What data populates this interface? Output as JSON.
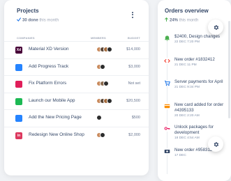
{
  "projects": {
    "title": "Projects",
    "done_count": "30 done",
    "done_period": "this month",
    "menu_icon": "more-vertical-icon",
    "columns": {
      "companies": "COMPANIES",
      "members": "MEMBERS",
      "budget": "BUDGET"
    },
    "rows": [
      {
        "name": "Material XD Version",
        "budget": "$14,000",
        "logo_icon": "adobe-xd-logo",
        "logo_text": "Xd",
        "logo_color": "#470137",
        "avatars": [
          "#c98b5e",
          "#5a4636",
          "#a36a3c",
          "#2d2d2d"
        ]
      },
      {
        "name": "Add Progress Track",
        "budget": "$3,000",
        "logo_icon": "atlassian-logo",
        "logo_text": "",
        "logo_color": "#2684ff",
        "avatars": [
          "#c98b5e",
          "#2d2d2d"
        ]
      },
      {
        "name": "Fix Platform Errors",
        "budget": "Not set",
        "logo_icon": "slack-logo",
        "logo_text": "",
        "logo_color": "#e01e5a",
        "avatars": [
          "#c98b5e",
          "#8a6a4e",
          "#2d2d2d"
        ]
      },
      {
        "name": "Launch our Mobile App",
        "budget": "$20,500",
        "logo_icon": "spotify-logo",
        "logo_text": "",
        "logo_color": "#1db954",
        "avatars": [
          "#c98b5e",
          "#5a4636",
          "#a36a3c",
          "#2d2d2d"
        ]
      },
      {
        "name": "Add the New Pricing Page",
        "budget": "$500",
        "logo_icon": "jira-logo",
        "logo_text": "",
        "logo_color": "#2684ff",
        "avatars": [
          "#2d2d2d"
        ]
      },
      {
        "name": "Redesign New Online Shop",
        "budget": "$2,000",
        "logo_icon": "invision-logo",
        "logo_text": "in",
        "logo_color": "#dc395f",
        "avatars": [
          "#c98b5e",
          "#2d2d2d"
        ]
      }
    ]
  },
  "orders": {
    "title": "Orders overview",
    "percent": "24%",
    "period": "this month",
    "trend_icon": "arrow-up-icon",
    "items": [
      {
        "title": "$2400, Design changes",
        "date": "22 DEC 7:20 PM",
        "icon": "bell-icon",
        "color": "#4caf50"
      },
      {
        "title": "New order #1832412",
        "date": "21 DEC 11 PM",
        "icon": "code-icon",
        "color": "#f44335"
      },
      {
        "title": "Server payments for April",
        "date": "21 DEC 9:34 PM",
        "icon": "cart-icon",
        "color": "#1a73e8"
      },
      {
        "title": "New card added for order #4395133",
        "date": "20 DEC 2:20 AM",
        "icon": "credit-card-icon",
        "color": "#fb8c00"
      },
      {
        "title": "Unlock packages for development",
        "date": "18 DEC 4:54 AM",
        "icon": "key-icon",
        "color": "#e91e63"
      },
      {
        "title": "New order #9583120",
        "date": "17 DEC",
        "icon": "money-icon",
        "color": "#344767"
      }
    ]
  },
  "settings_icon": "gear-icon"
}
